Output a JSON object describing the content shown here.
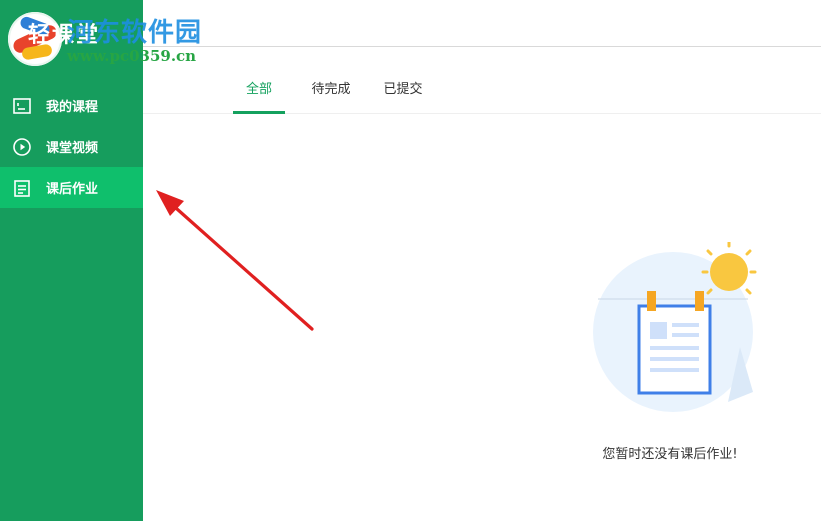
{
  "sidebar": {
    "brand_title": "轻课堂",
    "items": [
      {
        "label": "我的课程",
        "icon": "course-list-icon",
        "active": false
      },
      {
        "label": "课堂视频",
        "icon": "play-circle-icon",
        "active": false
      },
      {
        "label": "课后作业",
        "icon": "homework-icon",
        "active": true
      }
    ]
  },
  "watermark": {
    "title": "河东软件园",
    "url": "www.pc0359.cn"
  },
  "tabs": [
    {
      "label": "全部",
      "active": true
    },
    {
      "label": "待完成",
      "active": false
    },
    {
      "label": "已提交",
      "active": false
    }
  ],
  "empty_state": {
    "message": "您暂时还没有课后作业!",
    "illustration": "empty-homework-illustration"
  },
  "colors": {
    "sidebar_bg": "#169d5d",
    "sidebar_active": "#0fbf6c",
    "accent": "#14a15e",
    "arrow": "#e02020"
  }
}
